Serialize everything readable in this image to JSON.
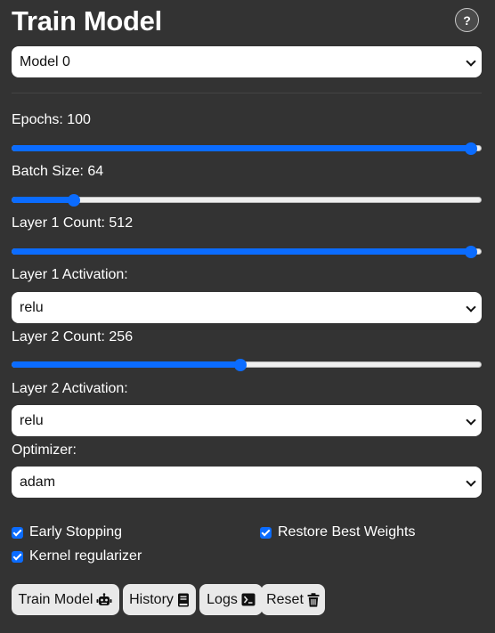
{
  "header": {
    "title": "Train Model",
    "help_glyph": "?"
  },
  "model_select": {
    "value": "Model 0"
  },
  "epochs": {
    "label": "Epochs: 100",
    "value": 100,
    "min": 1,
    "max": 100
  },
  "batch_size": {
    "label": "Batch Size: 64",
    "value": 64,
    "fraction": 0.13
  },
  "layer1_count": {
    "label": "Layer 1 Count: 512",
    "value": 512,
    "fraction": 1.0
  },
  "layer1_activation": {
    "label": "Layer 1 Activation:",
    "value": "relu"
  },
  "layer2_count": {
    "label": "Layer 2 Count: 256",
    "value": 256,
    "fraction": 0.5
  },
  "layer2_activation": {
    "label": "Layer 2 Activation:",
    "value": "relu"
  },
  "optimizer": {
    "label": "Optimizer:",
    "value": "adam"
  },
  "options": {
    "early_stopping": {
      "label": "Early Stopping",
      "checked": true
    },
    "restore_best_weights": {
      "label": "Restore Best Weights",
      "checked": true
    },
    "kernel_regularizer": {
      "label": "Kernel regularizer",
      "checked": true
    }
  },
  "buttons": {
    "train": {
      "label": "Train Model",
      "icon": "robot-icon"
    },
    "history": {
      "label": "History",
      "icon": "book-icon"
    },
    "logs": {
      "label": "Logs",
      "icon": "terminal-icon"
    },
    "reset": {
      "label": "Reset",
      "icon": "trash-icon"
    }
  },
  "colors": {
    "background": "#333333",
    "accent": "#0b6cff",
    "button_bg": "#e9e9e9"
  }
}
